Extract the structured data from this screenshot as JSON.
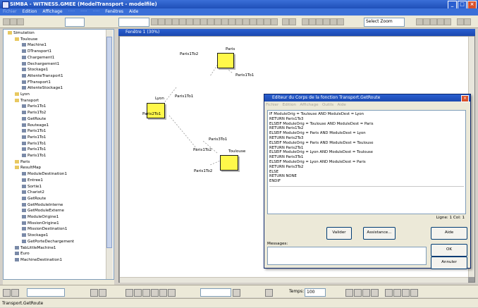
{
  "window": {
    "title": "SIMBA - WITNESS.GMEE (ModelTransport - modelfile)"
  },
  "menu": {
    "items": [
      {
        "label": "Fichier",
        "enabled": false
      },
      {
        "label": "Edition",
        "enabled": true
      },
      {
        "label": "Affichage",
        "enabled": true
      },
      {
        "label": "Fenêtres",
        "enabled": true
      },
      {
        "label": "Aide",
        "enabled": true
      }
    ]
  },
  "toolbar": {
    "zoom_combo_value": "Select Zoom"
  },
  "tree": {
    "items": [
      {
        "label": "Simulation",
        "indent": 0,
        "kind": "folder"
      },
      {
        "label": "Toulouse",
        "indent": 1,
        "kind": "folder"
      },
      {
        "label": "Machine1",
        "indent": 2,
        "kind": "item"
      },
      {
        "label": "DTransport1",
        "indent": 2,
        "kind": "item"
      },
      {
        "label": "Chargement1",
        "indent": 2,
        "kind": "item"
      },
      {
        "label": "Dechargement1",
        "indent": 2,
        "kind": "item"
      },
      {
        "label": "Stockage1",
        "indent": 2,
        "kind": "item"
      },
      {
        "label": "AttenteTransport1",
        "indent": 2,
        "kind": "item"
      },
      {
        "label": "FTransport1",
        "indent": 2,
        "kind": "item"
      },
      {
        "label": "AttenteStockage1",
        "indent": 2,
        "kind": "item"
      },
      {
        "label": "Lyon",
        "indent": 1,
        "kind": "folder"
      },
      {
        "label": "Transport",
        "indent": 1,
        "kind": "folder"
      },
      {
        "label": "Paris1To1",
        "indent": 2,
        "kind": "item"
      },
      {
        "label": "Paris1To2",
        "indent": 2,
        "kind": "item"
      },
      {
        "label": "GetRoute",
        "indent": 2,
        "kind": "item"
      },
      {
        "label": "Routeage1",
        "indent": 2,
        "kind": "item"
      },
      {
        "label": "Paris1To1",
        "indent": 2,
        "kind": "item"
      },
      {
        "label": "Paris1To1",
        "indent": 2,
        "kind": "item"
      },
      {
        "label": "Paris1To1",
        "indent": 2,
        "kind": "item"
      },
      {
        "label": "Paris1To1",
        "indent": 2,
        "kind": "item"
      },
      {
        "label": "Paris1To1",
        "indent": 2,
        "kind": "item"
      },
      {
        "label": "Paris",
        "indent": 1,
        "kind": "folder"
      },
      {
        "label": "ResultMap",
        "indent": 1,
        "kind": "folder"
      },
      {
        "label": "ModuleDestination1",
        "indent": 2,
        "kind": "item"
      },
      {
        "label": "Entree1",
        "indent": 2,
        "kind": "item"
      },
      {
        "label": "Sortie1",
        "indent": 2,
        "kind": "item"
      },
      {
        "label": "Chariot2",
        "indent": 2,
        "kind": "item"
      },
      {
        "label": "GetRoute",
        "indent": 2,
        "kind": "item"
      },
      {
        "label": "GetModuleInterne",
        "indent": 2,
        "kind": "item"
      },
      {
        "label": "GetModuleExterne",
        "indent": 2,
        "kind": "item"
      },
      {
        "label": "ModuleOrigine1",
        "indent": 2,
        "kind": "item"
      },
      {
        "label": "MissionOrigine1",
        "indent": 2,
        "kind": "item"
      },
      {
        "label": "MissionDestination1",
        "indent": 2,
        "kind": "item"
      },
      {
        "label": "Stockage1",
        "indent": 2,
        "kind": "item"
      },
      {
        "label": "GetPorteDechargement",
        "indent": 2,
        "kind": "item"
      },
      {
        "label": "TabLittleMachine1",
        "indent": 1,
        "kind": "item"
      },
      {
        "label": "Euro",
        "indent": 1,
        "kind": "item"
      },
      {
        "label": "MachineDestination1",
        "indent": 1,
        "kind": "item"
      }
    ]
  },
  "mdi": {
    "window_title": "Fenêtre 1 (30%)"
  },
  "diagram": {
    "nodes": [
      {
        "label": "Paris"
      },
      {
        "label": "Lyon"
      },
      {
        "label": "Toulouse"
      }
    ],
    "edge_labels": [
      "Paris1To2",
      "Paris1To1",
      "Paris1To1",
      "Paris2To1",
      "Paris3To1",
      "Paris1To2",
      "Paris1To2"
    ]
  },
  "editor": {
    "title": "Editeur du Corps de la fonction Transport.GetRoute",
    "menu_items": [
      "Fichier",
      "Edition",
      "Affichage",
      "Outils",
      "Aide"
    ],
    "code_lines": [
      "IF ModuleOrig = Toulouse AND ModuleDest = Lyon",
      "  RETURN Paris1To3",
      "ELSEIF ModuleOrig = Toulouse AND ModuleDest = Paris",
      "  RETURN Paris1To2",
      "ELSEIF ModuleOrig = Paris AND ModuleDest = Lyon",
      "  RETURN Paris2To3",
      "ELSEIF ModuleOrig = Paris AND ModuleDest = Toulouse",
      "  RETURN Paris2To1",
      "ELSEIF ModuleOrig = Lyon AND ModuleDest = Toulouse",
      "  RETURN Paris3To1",
      "ELSEIF ModuleOrig = Lyon AND ModuleDest = Paris",
      "  RETURN Paris3To2",
      "ELSE",
      "  RETURN NONE",
      "ENDIF"
    ],
    "position": "Ligne: 1 Col: 1",
    "buttons": {
      "validate": "Valider",
      "assistant": "Assistance...",
      "help": "Aide",
      "ok": "OK",
      "cancel": "Annuler"
    },
    "messages_label": "Messages:"
  },
  "statusbar": {
    "time_label": "Temps:",
    "time_value": "100",
    "text": "Transport.GetRoute"
  }
}
